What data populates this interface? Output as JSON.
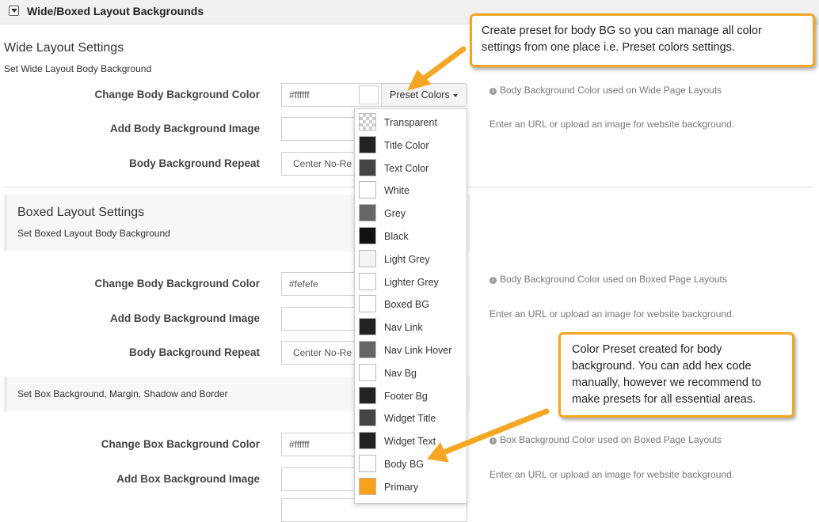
{
  "header": {
    "title": "Wide/Boxed Layout Backgrounds"
  },
  "wide": {
    "title": "Wide Layout Settings",
    "subtitle": "Set Wide Layout Body Background",
    "color_label": "Change Body Background Color",
    "color_value": "#ffffff",
    "preset_label": "Preset Colors",
    "color_help": "Body Background Color used on Wide Page Layouts",
    "image_label": "Add Body Background Image",
    "image_help": "Enter an URL or upload an image for website background.",
    "repeat_label": "Body Background Repeat",
    "repeat_value": "Center No-Re"
  },
  "boxed": {
    "title": "Boxed Layout Settings",
    "subtitle": "Set Boxed Layout Body Background",
    "color_label": "Change Body Background Color",
    "color_value": "#fefefe",
    "color_help": "Body Background Color used on Boxed Page Layouts",
    "image_label": "Add Body Background Image",
    "image_help": "Enter an URL or upload an image for website background.",
    "repeat_label": "Body Background Repeat",
    "repeat_value": "Center No-Re"
  },
  "box": {
    "subtitle": "Set Box Background, Margin, Shadow and Border",
    "color_label": "Change Box Background Color",
    "color_value": "#ffffff",
    "color_help": "Box Background Color used on Boxed Page Layouts",
    "image_label": "Add Box Background Image",
    "image_help": "Enter an URL or upload an image for website background."
  },
  "preset_menu": [
    {
      "label": "Transparent",
      "color": "transparent"
    },
    {
      "label": "Title Color",
      "color": "#222222"
    },
    {
      "label": "Text Color",
      "color": "#444444"
    },
    {
      "label": "White",
      "color": "#ffffff"
    },
    {
      "label": "Grey",
      "color": "#666666"
    },
    {
      "label": "Black",
      "color": "#111111"
    },
    {
      "label": "Light Grey",
      "color": "#f2f4f5"
    },
    {
      "label": "Lighter Grey",
      "color": "#ffffff"
    },
    {
      "label": "Boxed BG",
      "color": "#ffffff"
    },
    {
      "label": "Nav Link",
      "color": "#222222"
    },
    {
      "label": "Nav Link Hover",
      "color": "#666666"
    },
    {
      "label": "Nav Bg",
      "color": "#ffffff"
    },
    {
      "label": "Footer Bg",
      "color": "#222222"
    },
    {
      "label": "Widget Title",
      "color": "#444444"
    },
    {
      "label": "Widget Text",
      "color": "#222222"
    },
    {
      "label": "Body BG",
      "color": "#ffffff"
    },
    {
      "label": "Primary",
      "color": "#f7a21a"
    }
  ],
  "callouts": {
    "top": "Create preset for body BG so you can manage all color settings from one place i.e. Preset colors settings.",
    "bottom": "Color Preset created for body background. You can add hex code manually, however we recommend to make presets for all essential areas."
  },
  "colors": {
    "accent": "#f5a623"
  }
}
